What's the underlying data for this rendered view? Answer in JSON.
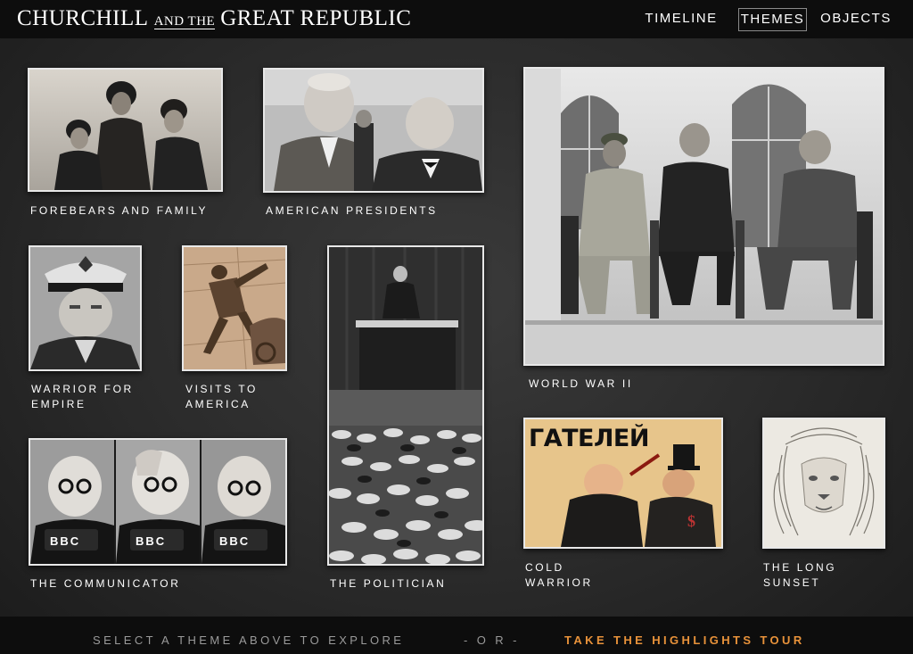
{
  "header": {
    "logo": {
      "part1": "CHURCHILL",
      "part2": "AND THE",
      "part3": "GREAT REPUBLIC"
    },
    "nav": [
      {
        "label": "TIMELINE",
        "active": false
      },
      {
        "label": "THEMES",
        "active": true
      },
      {
        "label": "OBJECTS",
        "active": false
      }
    ]
  },
  "themes": [
    {
      "label": "FOREBEARS AND FAMILY"
    },
    {
      "label": "AMERICAN PRESIDENTS"
    },
    {
      "label": "WORLD WAR II"
    },
    {
      "label_line1": "WARRIOR FOR",
      "label_line2": "EMPIRE"
    },
    {
      "label_line1": "VISITS TO",
      "label_line2": "AMERICA"
    },
    {
      "label": "THE POLITICIAN"
    },
    {
      "label": "THE COMMUNICATOR"
    },
    {
      "label_line1": "COLD",
      "label_line2": "WARRIOR"
    },
    {
      "label_line1": "THE LONG",
      "label_line2": "SUNSET"
    }
  ],
  "poster_text": "ГАТЕЛЕЙ",
  "bbc_text": "BBC",
  "footer": {
    "prompt": "SELECT A THEME ABOVE TO EXPLORE",
    "or": "- O R -",
    "tour": "TAKE THE HIGHLIGHTS TOUR"
  },
  "colors": {
    "accent_orange": "#e8923a",
    "header_bg": "#0d0d0d",
    "page_bg": "#2b2b2b",
    "tile_border": "#e8e8e8"
  }
}
